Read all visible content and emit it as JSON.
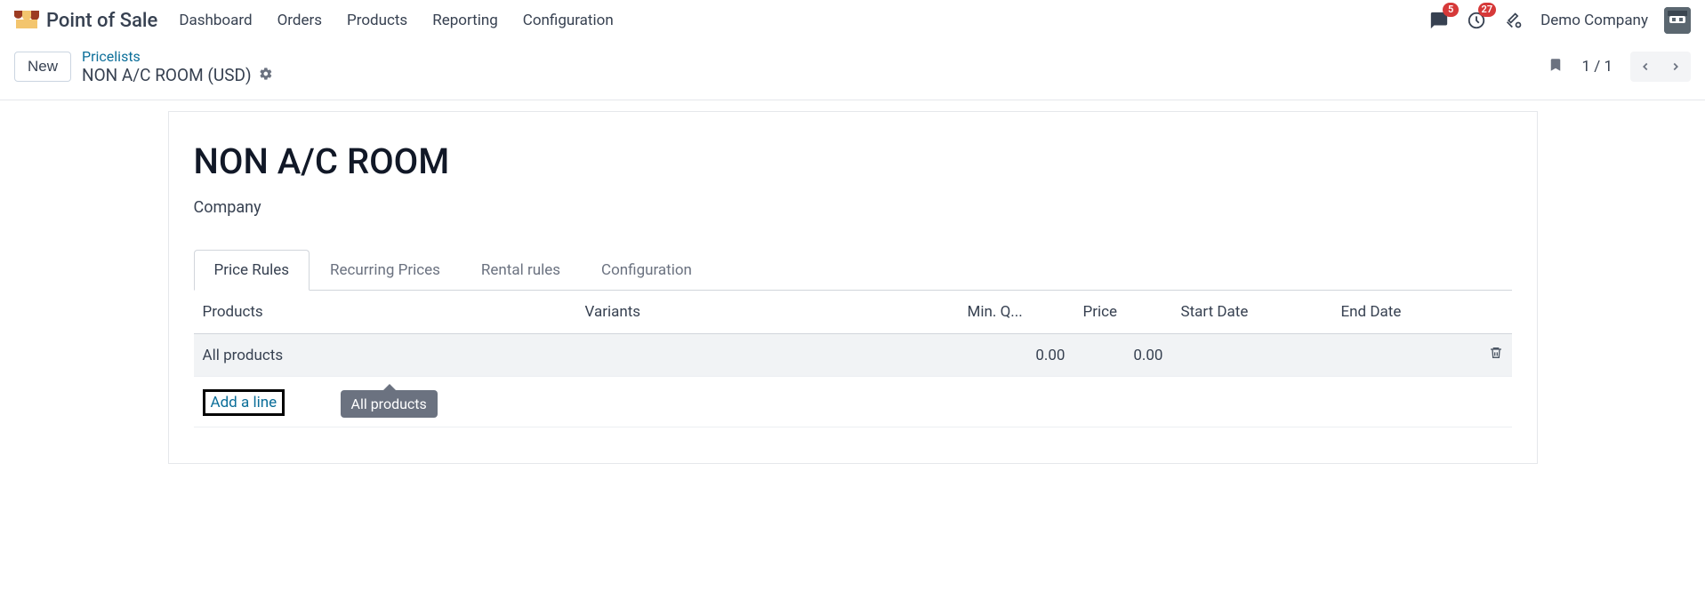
{
  "header": {
    "app_name": "Point of Sale",
    "nav": [
      "Dashboard",
      "Orders",
      "Products",
      "Reporting",
      "Configuration"
    ],
    "badges": {
      "messages": "5",
      "activities": "27"
    },
    "company": "Demo Company"
  },
  "control": {
    "new_label": "New",
    "breadcrumb_parent": "Pricelists",
    "breadcrumb_current": "NON A/C ROOM (USD)",
    "pager": "1 / 1"
  },
  "form": {
    "title": "NON A/C ROOM",
    "company_label": "Company",
    "tabs": [
      "Price Rules",
      "Recurring Prices",
      "Rental rules",
      "Configuration"
    ],
    "columns": {
      "products": "Products",
      "variants": "Variants",
      "min_qty": "Min. Q...",
      "price": "Price",
      "start_date": "Start Date",
      "end_date": "End Date"
    },
    "rows": [
      {
        "product": "All products",
        "variant": "",
        "min_qty": "0.00",
        "price": "0.00",
        "start": "",
        "end": ""
      }
    ],
    "add_line": "Add a line",
    "tooltip": "All products"
  }
}
